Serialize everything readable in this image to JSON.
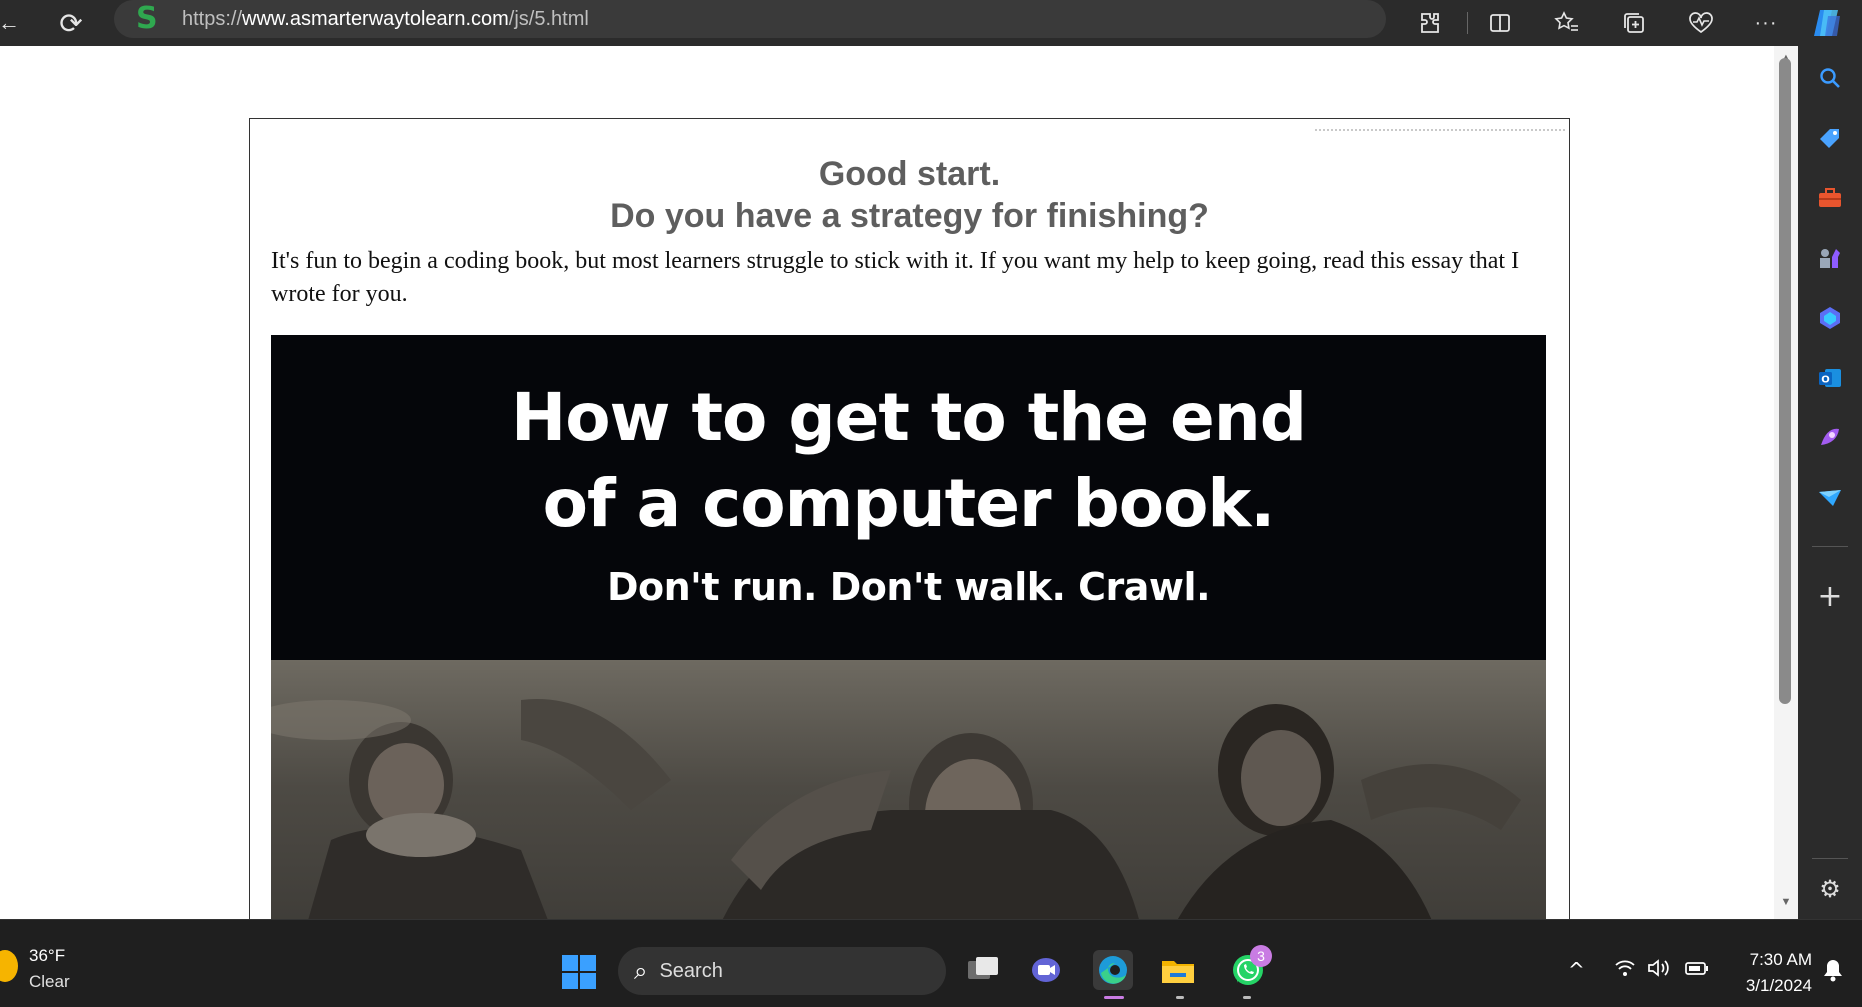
{
  "browser": {
    "back_icon": "←",
    "refresh_icon": "⟳",
    "site_icon": "S",
    "url_prefix": "https://",
    "url_domain": "www.asmarterwaytolearn.com",
    "url_path": "/js/5.html",
    "toolbar_icons": [
      "extensions-icon",
      "split-screen-icon",
      "favorites-icon",
      "collections-icon",
      "browser-essentials-icon",
      "more-icon",
      "copilot-icon"
    ],
    "more_glyph": "···"
  },
  "page": {
    "heading_line1": "Good start.",
    "heading_line2": "Do you have a strategy for finishing?",
    "paragraph": "It's fun to begin a coding book, but most learners struggle to stick with it. If you want my help to keep going, read this essay that I wrote for you.",
    "banner_line1": "How to get to the end",
    "banner_line2": "of a computer book.",
    "banner_tagline": "Don't run. Don't walk. Crawl."
  },
  "sidebar": {
    "icons": [
      "search-icon",
      "tag-icon",
      "toolbox-icon",
      "chess-icon",
      "copilot-app-icon",
      "outlook-icon",
      "designer-icon",
      "send-icon"
    ],
    "add_glyph": "+",
    "settings_glyph": "⚙"
  },
  "taskbar": {
    "weather_temp": "36°F",
    "weather_cond": "Clear",
    "search_placeholder": "Search",
    "whatsapp_badge": "3",
    "time": "7:30 AM",
    "date": "3/1/2024"
  },
  "colors": {
    "chrome_bg": "#2b2b2b",
    "heading": "#5e5e5e",
    "banner_bg": "#05060a",
    "accent_blue": "#3aa0ff"
  }
}
